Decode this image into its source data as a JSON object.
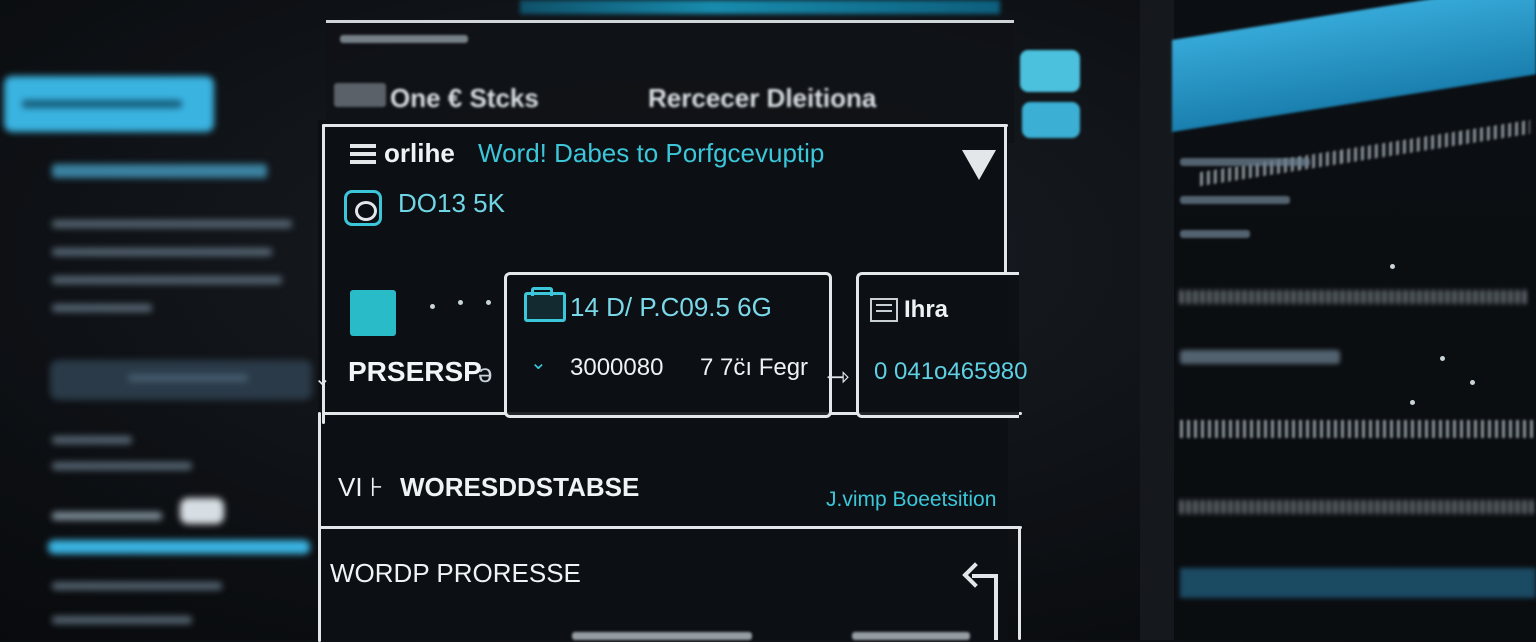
{
  "top_banner": {
    "text": ""
  },
  "window": {
    "small_title": "",
    "tabs": [
      "One € Stcks",
      "Rercecer Dleitiona"
    ]
  },
  "panel": {
    "menu_label": "orlihe",
    "title": "Word! Dabes to Porfgcevuptip",
    "account_label": "DO13 5K",
    "left_row_label": "PRSERSP",
    "left_row_suffix": "ə",
    "card": {
      "code": "14 D/ P.C09.5 6G",
      "value": "3000080",
      "unit": "7  7c̈ı Fegr"
    },
    "side_card": {
      "label": "Ihra",
      "value": "0 041o465980"
    },
    "row2_prefix": "VI ⊦",
    "row2_label": "WORESDDSTABSE",
    "row2_link": "J.vimp Boeetsition",
    "row3_label": "WORDP PRORESSE"
  },
  "left_sidebar": {
    "button_label": "",
    "heading": ""
  },
  "right_panel": {
    "text": ""
  },
  "colors": {
    "accent": "#3bc6d9",
    "line": "#e3e7ea",
    "background": "#0e1115",
    "sidebar_button": "#3ab3e0"
  },
  "icons": [
    "menu-icon",
    "camera-icon",
    "folder-icon",
    "chevron-down-icon",
    "arrow-right-icon",
    "server-icon",
    "return-arrow-icon",
    "dropdown-triangle-icon"
  ]
}
